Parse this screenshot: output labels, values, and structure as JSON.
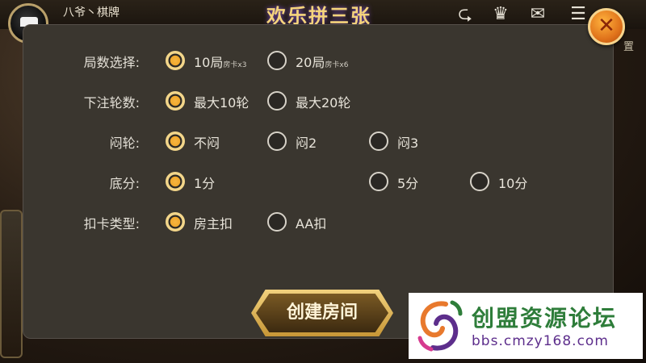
{
  "header": {
    "user_name": "八爷丶棋牌",
    "game_logo": "欢乐拼三张",
    "icons": [
      "share-icon",
      "crown-icon",
      "mail-icon",
      "more-icon",
      "gear-icon"
    ],
    "side_label": "置"
  },
  "dialog": {
    "close_icon": "close-icon",
    "rows": [
      {
        "label": "局数选择:",
        "options": [
          {
            "text": "10局",
            "sub": "房卡x3",
            "selected": true
          },
          {
            "text": "20局",
            "sub": "房卡x6",
            "selected": false
          }
        ]
      },
      {
        "label": "下注轮数:",
        "options": [
          {
            "text": "最大10轮",
            "selected": true
          },
          {
            "text": "最大20轮",
            "selected": false
          }
        ]
      },
      {
        "label": "闷轮:",
        "options": [
          {
            "text": "不闷",
            "selected": true
          },
          {
            "text": "闷2",
            "selected": false
          },
          {
            "text": "闷3",
            "selected": false
          }
        ]
      },
      {
        "label": "底分:",
        "options": [
          {
            "text": "1分",
            "selected": true
          },
          {
            "text": "5分",
            "selected": false
          },
          {
            "text": "10分",
            "selected": false
          }
        ]
      },
      {
        "label": "扣卡类型:",
        "options": [
          {
            "text": "房主扣",
            "selected": true
          },
          {
            "text": "AA扣",
            "selected": false
          }
        ]
      }
    ],
    "create_button": "创建房间"
  },
  "watermark": {
    "title": "创盟资源论坛",
    "url": "bbs.cmzy168.com"
  },
  "colors": {
    "dialog_bg": "#3a362f",
    "radio_selected": "#f0a82c",
    "close_button": "#e0731b",
    "button_gold": "#c79636"
  }
}
